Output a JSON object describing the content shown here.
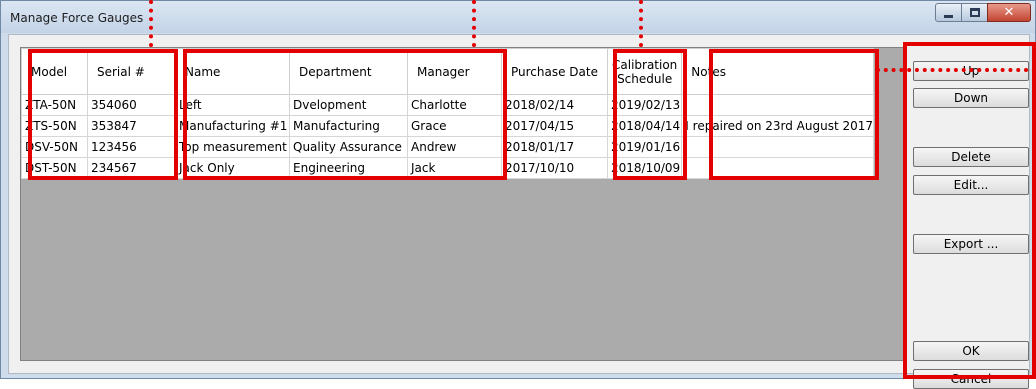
{
  "window": {
    "title": "Manage Force Gauges"
  },
  "table": {
    "headers": {
      "model": "Model",
      "serial": "Serial #",
      "name": "Name",
      "department": "Department",
      "manager": "Manager",
      "purchase_date": "Purchase Date",
      "calibration_line1": "Calibration",
      "calibration_line2": "Schedule",
      "notes": "Notes"
    },
    "rows": [
      {
        "model": "ZTA-50N",
        "serial": "354060",
        "name": "Left",
        "department": "Dvelopment",
        "manager": "Charlotte",
        "purchase_date": "2018/02/14",
        "calibration": "2019/02/13",
        "notes": ""
      },
      {
        "model": "ZTS-50N",
        "serial": "353847",
        "name": "Manufacturing #1",
        "department": "Manufacturing",
        "manager": "Grace",
        "purchase_date": "2017/04/15",
        "calibration": "2018/04/14",
        "notes": "I repaired on 23rd August 2017"
      },
      {
        "model": "DSV-50N",
        "serial": "123456",
        "name": "Top measurement",
        "department": "Quality Assurance",
        "manager": "Andrew",
        "purchase_date": "2018/01/17",
        "calibration": "2019/01/16",
        "notes": ""
      },
      {
        "model": "DST-50N",
        "serial": "234567",
        "name": "Jack Only",
        "department": "Engineering",
        "manager": "Jack",
        "purchase_date": "2017/10/10",
        "calibration": "2018/10/09",
        "notes": ""
      }
    ]
  },
  "buttons": {
    "up": "Up",
    "down": "Down",
    "delete": "Delete",
    "edit": "Edit...",
    "export": "Export ...",
    "ok": "OK",
    "cancel": "Cancel"
  },
  "colors": {
    "annotation_red": "#e30000",
    "grid_background": "#ababab",
    "titlebar": "#c3d4e7",
    "close_button": "#c24531"
  },
  "icons": {
    "minimize": "minimize-icon",
    "maximize": "maximize-icon",
    "close": "close-icon"
  }
}
